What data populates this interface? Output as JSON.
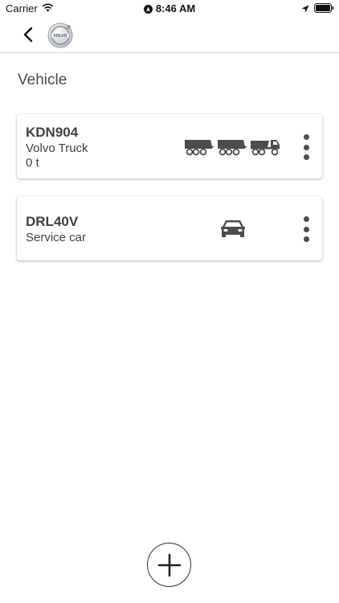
{
  "status_bar": {
    "carrier": "Carrier",
    "time": "8:46 AM"
  },
  "nav": {
    "logo_label": "VOLVO"
  },
  "page": {
    "title": "Vehicle"
  },
  "vehicles": [
    {
      "plate": "KDN904",
      "model": "Volvo Truck",
      "load": "0 t",
      "icons": [
        "trailer-icon",
        "trailer-icon",
        "dump-truck-icon"
      ]
    },
    {
      "plate": "DRL40V",
      "model": "Service car",
      "icons": [
        "car-icon"
      ]
    }
  ],
  "colors": {
    "text": "#404040",
    "icon": "#4d4d4d",
    "divider": "#d9d9d9"
  }
}
